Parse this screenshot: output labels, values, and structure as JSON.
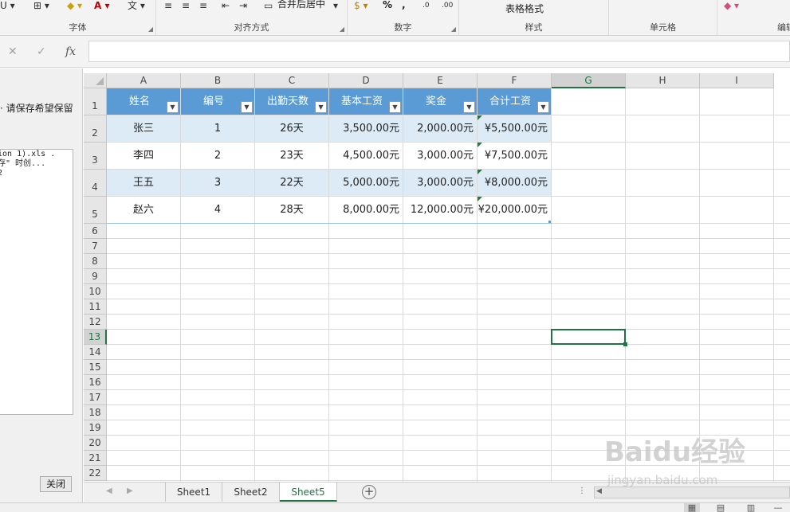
{
  "ribbon": {
    "groups": {
      "font": "字体",
      "alignment": "对齐方式",
      "number": "数字",
      "styles": "样式",
      "cells": "单元格",
      "editing": "编辑"
    },
    "merge_center": "合并后居中",
    "table_format": "表格格式",
    "percent": "%",
    "comma": ","
  },
  "formula_bar": {
    "fx": "fx",
    "cancel": "✕",
    "enter": "✓",
    "value": ""
  },
  "left_panel": {
    "message": "请保存希望保留",
    "lines": [
      "ion 1).xls .",
      "存\" 时创...",
      "2"
    ],
    "close_button": "关闭"
  },
  "columns": [
    "A",
    "B",
    "C",
    "D",
    "E",
    "F",
    "G",
    "H",
    "I"
  ],
  "rows": [
    "1",
    "2",
    "3",
    "4",
    "5",
    "6",
    "7",
    "8",
    "9",
    "10",
    "11",
    "12",
    "13",
    "14",
    "15",
    "16",
    "17",
    "18",
    "19",
    "20",
    "21",
    "22"
  ],
  "table": {
    "headers": [
      "姓名",
      "编号",
      "出勤天数",
      "基本工资",
      "奖金",
      "合计工资"
    ],
    "rows": [
      [
        "张三",
        "1",
        "26天",
        "3,500.00元",
        "2,000.00元",
        "¥5,500.00元"
      ],
      [
        "李四",
        "2",
        "23天",
        "4,500.00元",
        "3,000.00元",
        "¥7,500.00元"
      ],
      [
        "王五",
        "3",
        "22天",
        "5,000.00元",
        "3,000.00元",
        "¥8,000.00元"
      ],
      [
        "赵六",
        "4",
        "28天",
        "8,000.00元",
        "12,000.00元",
        "¥20,000.00元"
      ]
    ]
  },
  "sheets": {
    "tabs": [
      "Sheet1",
      "Sheet2",
      "Sheet5"
    ],
    "active": "Sheet5"
  },
  "watermark": {
    "main": "Baidu经验",
    "sub": "jingyan.baidu.com"
  },
  "colors": {
    "accent": "#217346",
    "table_header": "#5b9bd5",
    "band": "#ddebf7"
  }
}
